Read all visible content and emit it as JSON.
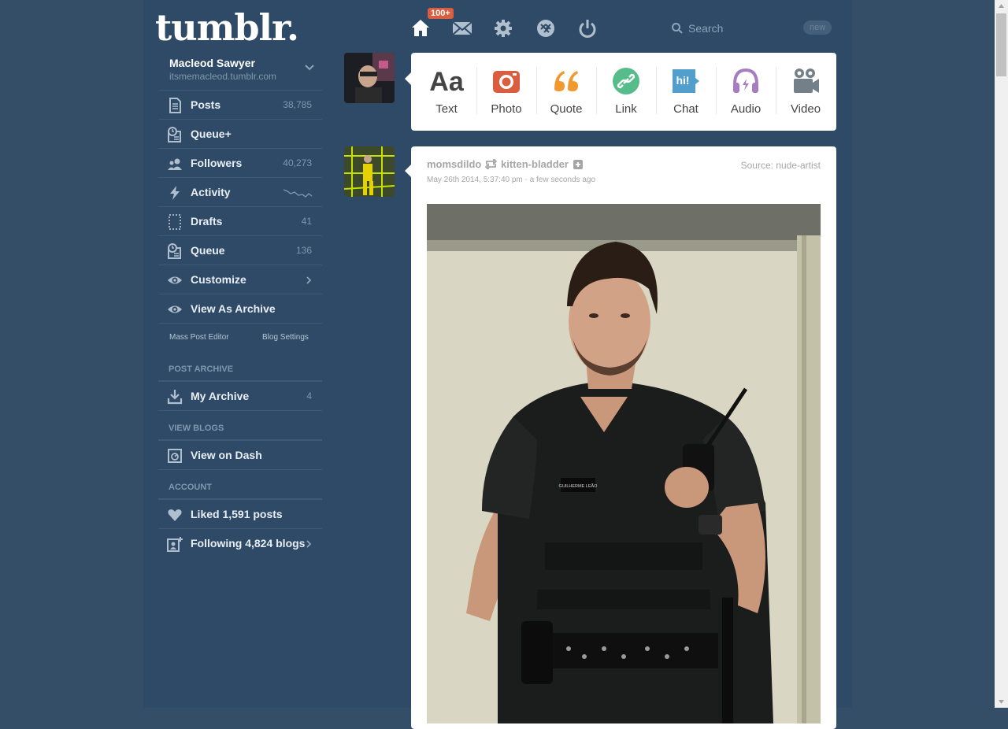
{
  "app": {
    "logo": "tumblr."
  },
  "topnav": {
    "badge": "100+",
    "search_placeholder": "Search",
    "new_label": "new"
  },
  "blog": {
    "name": "Macleod Sawyer",
    "url": "itsmemacleod.tumblr.com"
  },
  "sidebar": {
    "items": [
      {
        "label": "Posts",
        "count": "38,785",
        "icon": "posts-icon"
      },
      {
        "label": "Queue+",
        "count": "",
        "icon": "queue-plus-icon"
      },
      {
        "label": "Followers",
        "count": "40,273",
        "icon": "followers-icon"
      },
      {
        "label": "Activity",
        "count": "",
        "icon": "activity-icon"
      },
      {
        "label": "Drafts",
        "count": "41",
        "icon": "drafts-icon"
      },
      {
        "label": "Queue",
        "count": "136",
        "icon": "queue-icon"
      },
      {
        "label": "Customize",
        "count": "",
        "icon": "eye-icon"
      },
      {
        "label": "View As Archive",
        "count": "",
        "icon": "eye-icon"
      }
    ],
    "links": {
      "mass_post_editor": "Mass Post Editor",
      "blog_settings": "Blog Settings"
    },
    "post_archive": {
      "heading": "POST ARCHIVE",
      "my_archive": "My Archive",
      "my_archive_count": "4"
    },
    "view_blogs": {
      "heading": "VIEW BLOGS",
      "view_on_dash": "View on Dash"
    },
    "account": {
      "heading": "ACCOUNT",
      "liked": "Liked 1,591 posts",
      "following": "Following 4,824 blogs"
    }
  },
  "composer": {
    "types": [
      {
        "label": "Text",
        "color": "#444444",
        "icon": "text-icon"
      },
      {
        "label": "Photo",
        "color": "#d95e40",
        "icon": "camera-icon"
      },
      {
        "label": "Quote",
        "color": "#f2992e",
        "icon": "quote-icon"
      },
      {
        "label": "Link",
        "color": "#56bc8a",
        "icon": "link-icon"
      },
      {
        "label": "Chat",
        "color": "#529ecc",
        "icon": "chat-icon"
      },
      {
        "label": "Audio",
        "color": "#a77dc2",
        "icon": "headphones-icon"
      },
      {
        "label": "Video",
        "color": "#748089",
        "icon": "video-camera-icon"
      }
    ],
    "text_glyph": "Aa",
    "chat_glyph": "hi!"
  },
  "post": {
    "user": "momsdildo",
    "reblogged_from": "kitten-bladder",
    "date": "May 26th 2014, 5:37:40 pm · a few seconds ago",
    "source": "Source: nude-artist",
    "name_tag": "GUILHERME LEÃO"
  },
  "colors": {
    "bg": "#344e67",
    "sidebar_text": "#e8eef4",
    "muted": "#7f97ae",
    "badge": "#d95e40"
  }
}
